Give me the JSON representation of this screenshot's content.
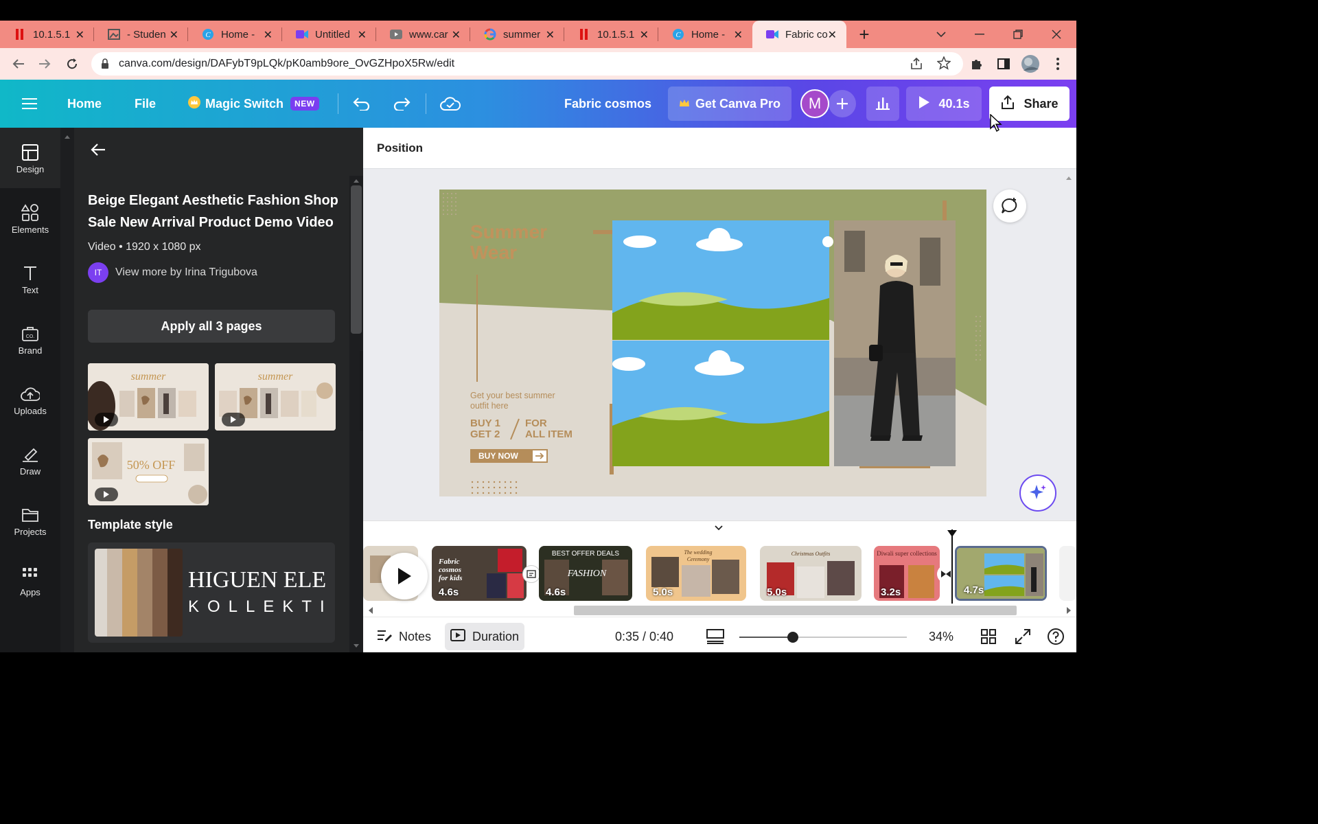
{
  "browser": {
    "tabs": [
      {
        "label": "10.1.5.1"
      },
      {
        "label": "- Studen"
      },
      {
        "label": "Home -"
      },
      {
        "label": "Untitled"
      },
      {
        "label": "www.car"
      },
      {
        "label": "summer"
      },
      {
        "label": "10.1.5.1"
      },
      {
        "label": "Home -"
      },
      {
        "label": "Fabric co"
      }
    ],
    "url": "canva.com/design/DAFybT9pLQk/pK0amb9ore_OvGZHpoX5Rw/edit"
  },
  "header": {
    "home": "Home",
    "file": "File",
    "magic_switch": "Magic Switch",
    "new_badge": "NEW",
    "design_name": "Fabric cosmos",
    "get_pro": "Get Canva Pro",
    "avatar_letter": "M",
    "play_time": "40.1s",
    "share": "Share"
  },
  "rail": {
    "items": [
      {
        "label": "Design"
      },
      {
        "label": "Elements"
      },
      {
        "label": "Text"
      },
      {
        "label": "Brand"
      },
      {
        "label": "Uploads"
      },
      {
        "label": "Draw"
      },
      {
        "label": "Projects"
      },
      {
        "label": "Apps"
      }
    ]
  },
  "panel": {
    "title": "Beige Elegant Aesthetic Fashion Shop Sale New Arrival Product Demo Video",
    "meta": "Video • 1920 x 1080 px",
    "author_initials": "IT",
    "author": "View more by Irina Trigubova",
    "apply": "Apply all 3 pages",
    "thumb1_text": "summer",
    "thumb2_text": "summer",
    "thumb3_text": "50% OFF",
    "template_style": "Template style",
    "style_line1": "HIGUEN ELE",
    "style_line2": "KOLLEKTI"
  },
  "toolbar": {
    "position": "Position"
  },
  "design": {
    "title_line1": "Summer",
    "title_line2": "Wear",
    "tagline_line1": "Get your best summer",
    "tagline_line2": "outfit here",
    "buy1": "BUY 1",
    "get2": "GET 2",
    "for": "FOR",
    "all_item": "ALL ITEM",
    "buy_now": "BUY NOW"
  },
  "timeline": {
    "clips": [
      {
        "label": "Fabric cosmos for kids",
        "duration": "4.6s"
      },
      {
        "label": "BEST OFFER DEALS",
        "label2": "FASHION",
        "duration": "4.6s"
      },
      {
        "label": "The wedding Ceremony",
        "duration": "5.0s"
      },
      {
        "label": "Christmas Outfits",
        "duration": "5.0s"
      },
      {
        "label": "Diwali super collections",
        "duration": "3.2s"
      },
      {
        "label": "",
        "duration": "4.7s"
      }
    ]
  },
  "bottombar": {
    "notes": "Notes",
    "duration": "Duration",
    "time": "0:35 / 0:40",
    "zoom": "34%",
    "zoom_level": 0.32
  },
  "colors": {
    "header_start": "#10b8c8",
    "header_end": "#7b3ff0",
    "olive": "#9aa36a",
    "beige": "#dfd9cf",
    "gold": "#b58d5a",
    "tab_strip": "#f28b82"
  }
}
